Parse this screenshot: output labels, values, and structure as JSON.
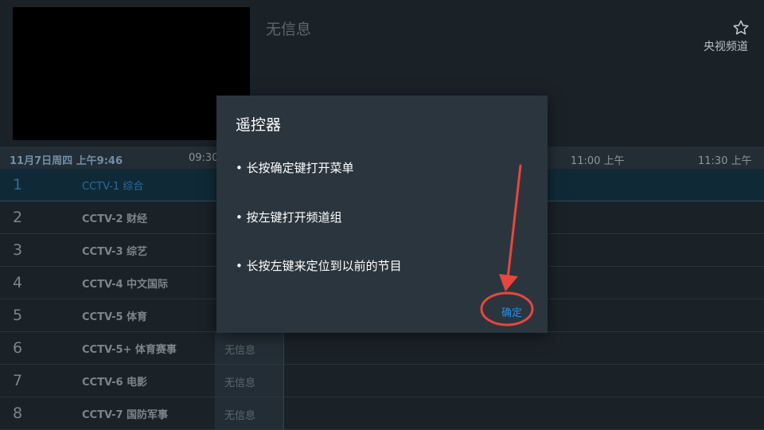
{
  "header": {
    "program_info": "无信息",
    "favorite_icon": "star-icon",
    "channel_group": "央视频道"
  },
  "timebar": {
    "date": "11月7日周四 上午9:46",
    "times": [
      "09:30",
      "11:00 上午",
      "11:30 上午"
    ]
  },
  "channels": [
    {
      "number": "1",
      "name": "CCTV-1 综合",
      "program": ""
    },
    {
      "number": "2",
      "name": "CCTV-2 财经",
      "program": ""
    },
    {
      "number": "3",
      "name": "CCTV-3 综艺",
      "program": ""
    },
    {
      "number": "4",
      "name": "CCTV-4 中文国际",
      "program": ""
    },
    {
      "number": "5",
      "name": "CCTV-5 体育",
      "program": ""
    },
    {
      "number": "6",
      "name": "CCTV-5+ 体育赛事",
      "program": "无信息"
    },
    {
      "number": "7",
      "name": "CCTV-6 电影",
      "program": "无信息"
    },
    {
      "number": "8",
      "name": "CCTV-7 国防军事",
      "program": "无信息"
    }
  ],
  "dialog": {
    "title": "遥控器",
    "lines": [
      "• 长按确定键打开菜单",
      "• 按左键打开频道组",
      "• 长按左键来定位到以前的节目"
    ],
    "ok": "确定"
  },
  "colors": {
    "accent": "#2b8fe0",
    "annotation": "#e8463f",
    "dialog_bg": "#2b353d",
    "background": "#1a2127"
  }
}
